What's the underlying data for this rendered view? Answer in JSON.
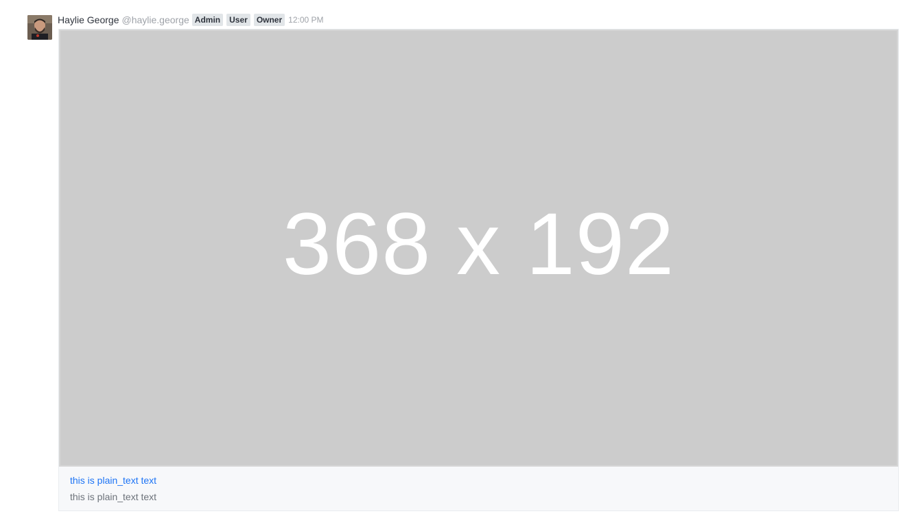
{
  "message": {
    "author_name": "Haylie George",
    "username": "@haylie.george",
    "roles": [
      "Admin",
      "User",
      "Owner"
    ],
    "time": "12:00 PM",
    "attachment": {
      "image_placeholder_text": "368 x 192",
      "title_link": "this is plain_text text",
      "text": "this is plain_text text"
    }
  },
  "colors": {
    "link": "#1d74f5",
    "placeholder_bg": "#cccccc",
    "badge_bg": "#e1e5e8"
  },
  "icons": {
    "avatar": "user-avatar"
  }
}
